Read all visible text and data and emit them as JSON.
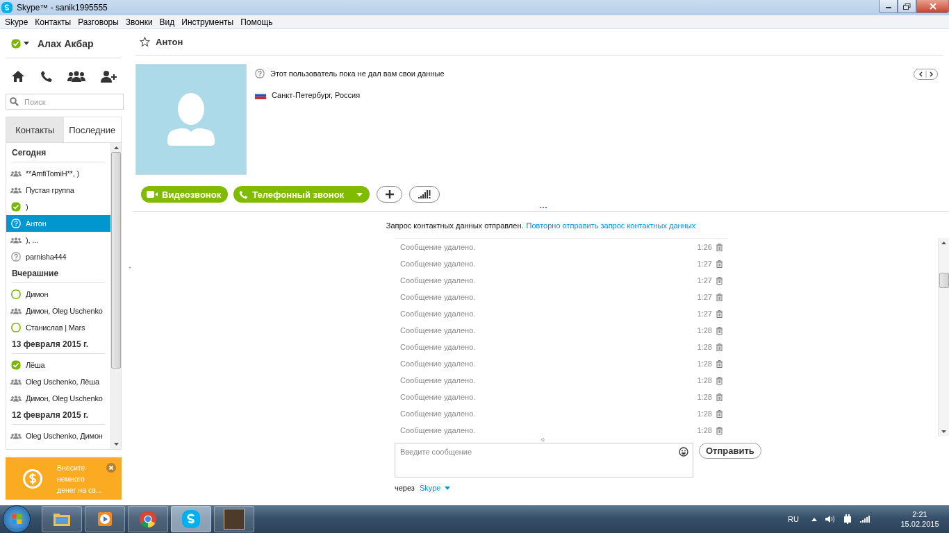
{
  "window": {
    "title": "Skype™ - sanik1995555"
  },
  "menu": [
    "Skype",
    "Контакты",
    "Разговоры",
    "Звонки",
    "Вид",
    "Инструменты",
    "Помощь"
  ],
  "sidebar": {
    "user_name": "Алах Акбар",
    "search": {
      "placeholder": "Поиск"
    },
    "tabs": [
      {
        "label": "Контакты",
        "selected": false
      },
      {
        "label": "Последние",
        "selected": true
      }
    ],
    "sections": [
      {
        "title": "Сегодня",
        "items": [
          {
            "name": "**AmfiTomiH**, )",
            "kind": "group",
            "selected": false
          },
          {
            "name": "Пустая группа",
            "kind": "group",
            "selected": false
          },
          {
            "name": ")",
            "kind": "online",
            "selected": false
          },
          {
            "name": "Антон",
            "kind": "unknown",
            "selected": true
          },
          {
            "name": "), ...",
            "kind": "group",
            "selected": false
          },
          {
            "name": "parnisha444",
            "kind": "unknown",
            "selected": false
          }
        ]
      },
      {
        "title": "Вчерашние",
        "items": [
          {
            "name": "Димон",
            "kind": "outline",
            "selected": false
          },
          {
            "name": "Димон, Oleg Uschenko",
            "kind": "group",
            "selected": false
          },
          {
            "name": "Станислав | Mars",
            "kind": "outline",
            "selected": false
          }
        ]
      },
      {
        "title": "13 февраля 2015 г.",
        "items": [
          {
            "name": "Лёша",
            "kind": "online",
            "selected": false
          },
          {
            "name": "Oleg Uschenko, Лёша",
            "kind": "group",
            "selected": false
          },
          {
            "name": "Димон, Oleg Uschenko",
            "kind": "group",
            "selected": false
          }
        ]
      },
      {
        "title": "12 февраля 2015 г.",
        "items": [
          {
            "name": "Oleg Uschenko, Димон",
            "kind": "group",
            "selected": false
          }
        ]
      }
    ],
    "promo": {
      "text": "Внесите немного денег на св..."
    }
  },
  "contact": {
    "name": "Антон",
    "status_note": "Этот пользователь пока не дал вам свои данные",
    "location": "Санкт-Петербург, Россия",
    "video_button": "Видеозвонок",
    "phone_button": "Телефонный звонок"
  },
  "chat": {
    "notice": "Запрос контактных данных отправлен.",
    "notice_link": "Повторно отправить запрос контактных данных",
    "messages": [
      {
        "text": "Сообщение удалено.",
        "time": "1:26"
      },
      {
        "text": "Сообщение удалено.",
        "time": "1:27"
      },
      {
        "text": "Сообщение удалено.",
        "time": "1:27"
      },
      {
        "text": "Сообщение удалено.",
        "time": "1:27"
      },
      {
        "text": "Сообщение удалено.",
        "time": "1:27"
      },
      {
        "text": "Сообщение удалено.",
        "time": "1:28"
      },
      {
        "text": "Сообщение удалено.",
        "time": "1:28"
      },
      {
        "text": "Сообщение удалено.",
        "time": "1:28"
      },
      {
        "text": "Сообщение удалено.",
        "time": "1:28"
      },
      {
        "text": "Сообщение удалено.",
        "time": "1:28"
      },
      {
        "text": "Сообщение удалено.",
        "time": "1:28"
      },
      {
        "text": "Сообщение удалено.",
        "time": "1:28"
      }
    ],
    "input": {
      "placeholder": "Введите сообщение"
    },
    "send_button": "Отправить",
    "via_label": "через",
    "via_link": "Skype"
  },
  "taskbar": {
    "apps": [
      {
        "kind": "folder",
        "active": false
      },
      {
        "kind": "media",
        "active": false
      },
      {
        "kind": "browser",
        "active": false
      },
      {
        "kind": "skype",
        "active": true
      },
      {
        "kind": "game",
        "active": false
      }
    ],
    "language": "RU",
    "time": "2:21",
    "date": "15.02.2015"
  }
}
